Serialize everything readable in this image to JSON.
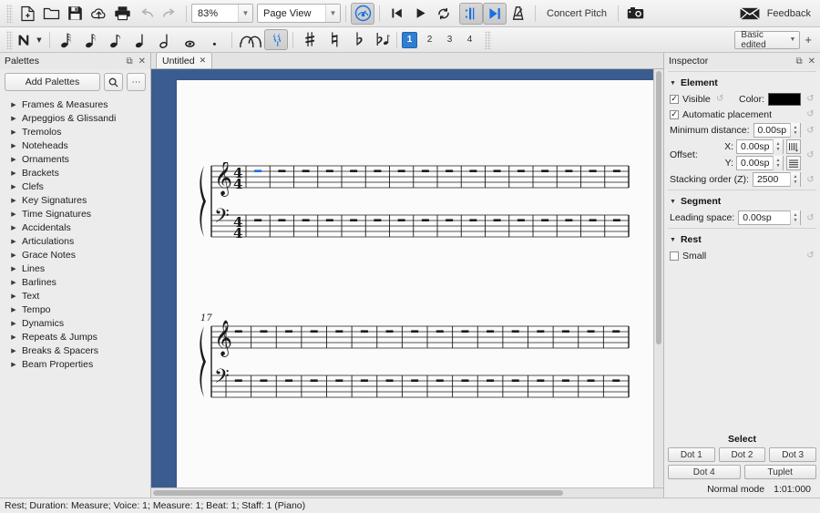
{
  "toolbar_main": {
    "buttons": [
      {
        "name": "new-score-button",
        "icon": "new-file-icon",
        "tooltip": "New Score"
      },
      {
        "name": "open-score-button",
        "icon": "open-folder-icon",
        "tooltip": "Open"
      },
      {
        "name": "save-score-button",
        "icon": "save-disk-icon",
        "tooltip": "Save"
      },
      {
        "name": "save-online-button",
        "icon": "cloud-upload-icon",
        "tooltip": "Save Online"
      },
      {
        "name": "print-button",
        "icon": "printer-icon",
        "tooltip": "Print"
      },
      {
        "name": "undo-button",
        "icon": "undo-arrow-icon",
        "tooltip": "Undo"
      },
      {
        "name": "redo-button",
        "icon": "redo-arrow-icon",
        "tooltip": "Redo"
      }
    ],
    "zoom": {
      "value": "83%",
      "name": "zoom-combo"
    },
    "view_mode": {
      "value": "Page View",
      "name": "view-mode-combo"
    },
    "play_buttons": [
      {
        "name": "play-panel-button",
        "icon": "play-panel-icon",
        "active": true
      },
      {
        "name": "rewind-button",
        "icon": "rewind-start-icon",
        "active": false
      },
      {
        "name": "play-button",
        "icon": "play-triangle-icon",
        "active": false
      },
      {
        "name": "loop-playback-button",
        "icon": "loop-circular-icon",
        "active": false
      },
      {
        "name": "loop-in-button",
        "icon": "loop-in-marker-icon",
        "active": true
      },
      {
        "name": "loop-out-button",
        "icon": "loop-out-marker-icon",
        "active": true
      },
      {
        "name": "metronome-button",
        "icon": "metronome-icon",
        "active": false
      }
    ],
    "concert_pitch_label": "Concert Pitch",
    "image_capture": {
      "name": "image-capture-button",
      "icon": "camera-icon"
    },
    "feedback_label": "Feedback",
    "feedback_icon": "envelope-icon"
  },
  "toolbar_note": {
    "note_input_label": "N",
    "durations": [
      {
        "name": "duration-64th",
        "glyph": "♬",
        "label": "64th note"
      },
      {
        "name": "duration-32nd",
        "glyph": "♬",
        "label": "32nd note"
      },
      {
        "name": "duration-eighth",
        "glyph": "♪",
        "label": "Eighth note"
      },
      {
        "name": "duration-quarter",
        "glyph": "♩",
        "label": "Quarter note"
      },
      {
        "name": "duration-half",
        "glyph": "𝅗𝅥",
        "label": "Half note"
      },
      {
        "name": "duration-whole",
        "glyph": "𝅝",
        "label": "Whole note"
      },
      {
        "name": "duration-dot",
        "glyph": "·",
        "label": "Augmentation dot"
      }
    ],
    "tie_label": "Tie",
    "rest_label": "Rest",
    "rest_active": true,
    "accidentals": [
      {
        "name": "accidental-sharp",
        "glyph": "♯",
        "label": "Sharp"
      },
      {
        "name": "accidental-natural",
        "glyph": "♮",
        "label": "Natural"
      },
      {
        "name": "accidental-flat",
        "glyph": "♭",
        "label": "Flat"
      },
      {
        "name": "accidental-flip",
        "glyph": "⁑",
        "label": "Flip direction"
      }
    ],
    "voices": [
      {
        "label": "1",
        "selected": true
      },
      {
        "label": "2",
        "selected": false
      },
      {
        "label": "3",
        "selected": false
      },
      {
        "label": "4",
        "selected": false
      }
    ],
    "workspace": {
      "value": "Basic edited",
      "name": "workspace-combo"
    },
    "workspace_add": "+"
  },
  "palettes": {
    "title": "Palettes",
    "undock_icon": "undock-icon",
    "close_icon": "close-icon",
    "add_palettes_label": "Add Palettes",
    "search_icon": "search-icon",
    "more_icon": "more-options-icon",
    "items": [
      {
        "label": "Frames & Measures"
      },
      {
        "label": "Arpeggios & Glissandi"
      },
      {
        "label": "Tremolos"
      },
      {
        "label": "Noteheads"
      },
      {
        "label": "Ornaments"
      },
      {
        "label": "Brackets"
      },
      {
        "label": "Clefs"
      },
      {
        "label": "Key Signatures"
      },
      {
        "label": "Time Signatures"
      },
      {
        "label": "Accidentals"
      },
      {
        "label": "Articulations"
      },
      {
        "label": "Grace Notes"
      },
      {
        "label": "Lines"
      },
      {
        "label": "Barlines"
      },
      {
        "label": "Text"
      },
      {
        "label": "Tempo"
      },
      {
        "label": "Dynamics"
      },
      {
        "label": "Repeats & Jumps"
      },
      {
        "label": "Breaks & Spacers"
      },
      {
        "label": "Beam Properties"
      }
    ]
  },
  "document": {
    "tab_label": "Untitled",
    "tab_close_icon": "close-icon"
  },
  "score": {
    "systems": [
      {
        "measure_number": "",
        "measures": 16,
        "time_signature": "4/4",
        "treble_clef": "treble-clef",
        "bass_clef": "bass-clef",
        "selected_measure": 1,
        "selection_color": "#1a6fe0"
      },
      {
        "measure_number": "17",
        "measures": 16,
        "time_signature": "",
        "treble_clef": "treble-clef",
        "bass_clef": "bass-clef",
        "selected_measure": 0,
        "selection_color": "#1a6fe0"
      }
    ]
  },
  "inspector": {
    "title": "Inspector",
    "undock_icon": "undock-icon",
    "close_icon": "close-icon",
    "sections": {
      "element": {
        "title": "Element",
        "visible_label": "Visible",
        "visible_checked": true,
        "color_label": "Color:",
        "color_value": "#000000",
        "automatic_placement_label": "Automatic placement",
        "automatic_placement_checked": true,
        "minimum_distance_label": "Minimum distance:",
        "minimum_distance_value": "0.00sp",
        "offset_label": "Offset:",
        "offset_x_label": "X:",
        "offset_x_value": "0.00sp",
        "offset_y_label": "Y:",
        "offset_y_value": "0.00sp",
        "stacking_order_label": "Stacking order (Z):",
        "stacking_order_value": "2500"
      },
      "segment": {
        "title": "Segment",
        "leading_space_label": "Leading space:",
        "leading_space_value": "0.00sp"
      },
      "rest": {
        "title": "Rest",
        "small_label": "Small",
        "small_checked": false
      }
    },
    "select_label": "Select",
    "select_buttons": [
      {
        "label": "Dot 1",
        "name": "dot-1-button"
      },
      {
        "label": "Dot 2",
        "name": "dot-2-button"
      },
      {
        "label": "Dot 3",
        "name": "dot-3-button"
      },
      {
        "label": "Dot 4",
        "name": "dot-4-button"
      },
      {
        "label": "Tuplet",
        "name": "tuplet-button"
      }
    ],
    "mode_label": "Normal mode",
    "timecode": "1:01:000"
  },
  "status_bar": {
    "text": "Rest; Duration: Measure; Voice: 1;  Measure: 1; Beat: 1; Staff: 1 (Piano)"
  }
}
